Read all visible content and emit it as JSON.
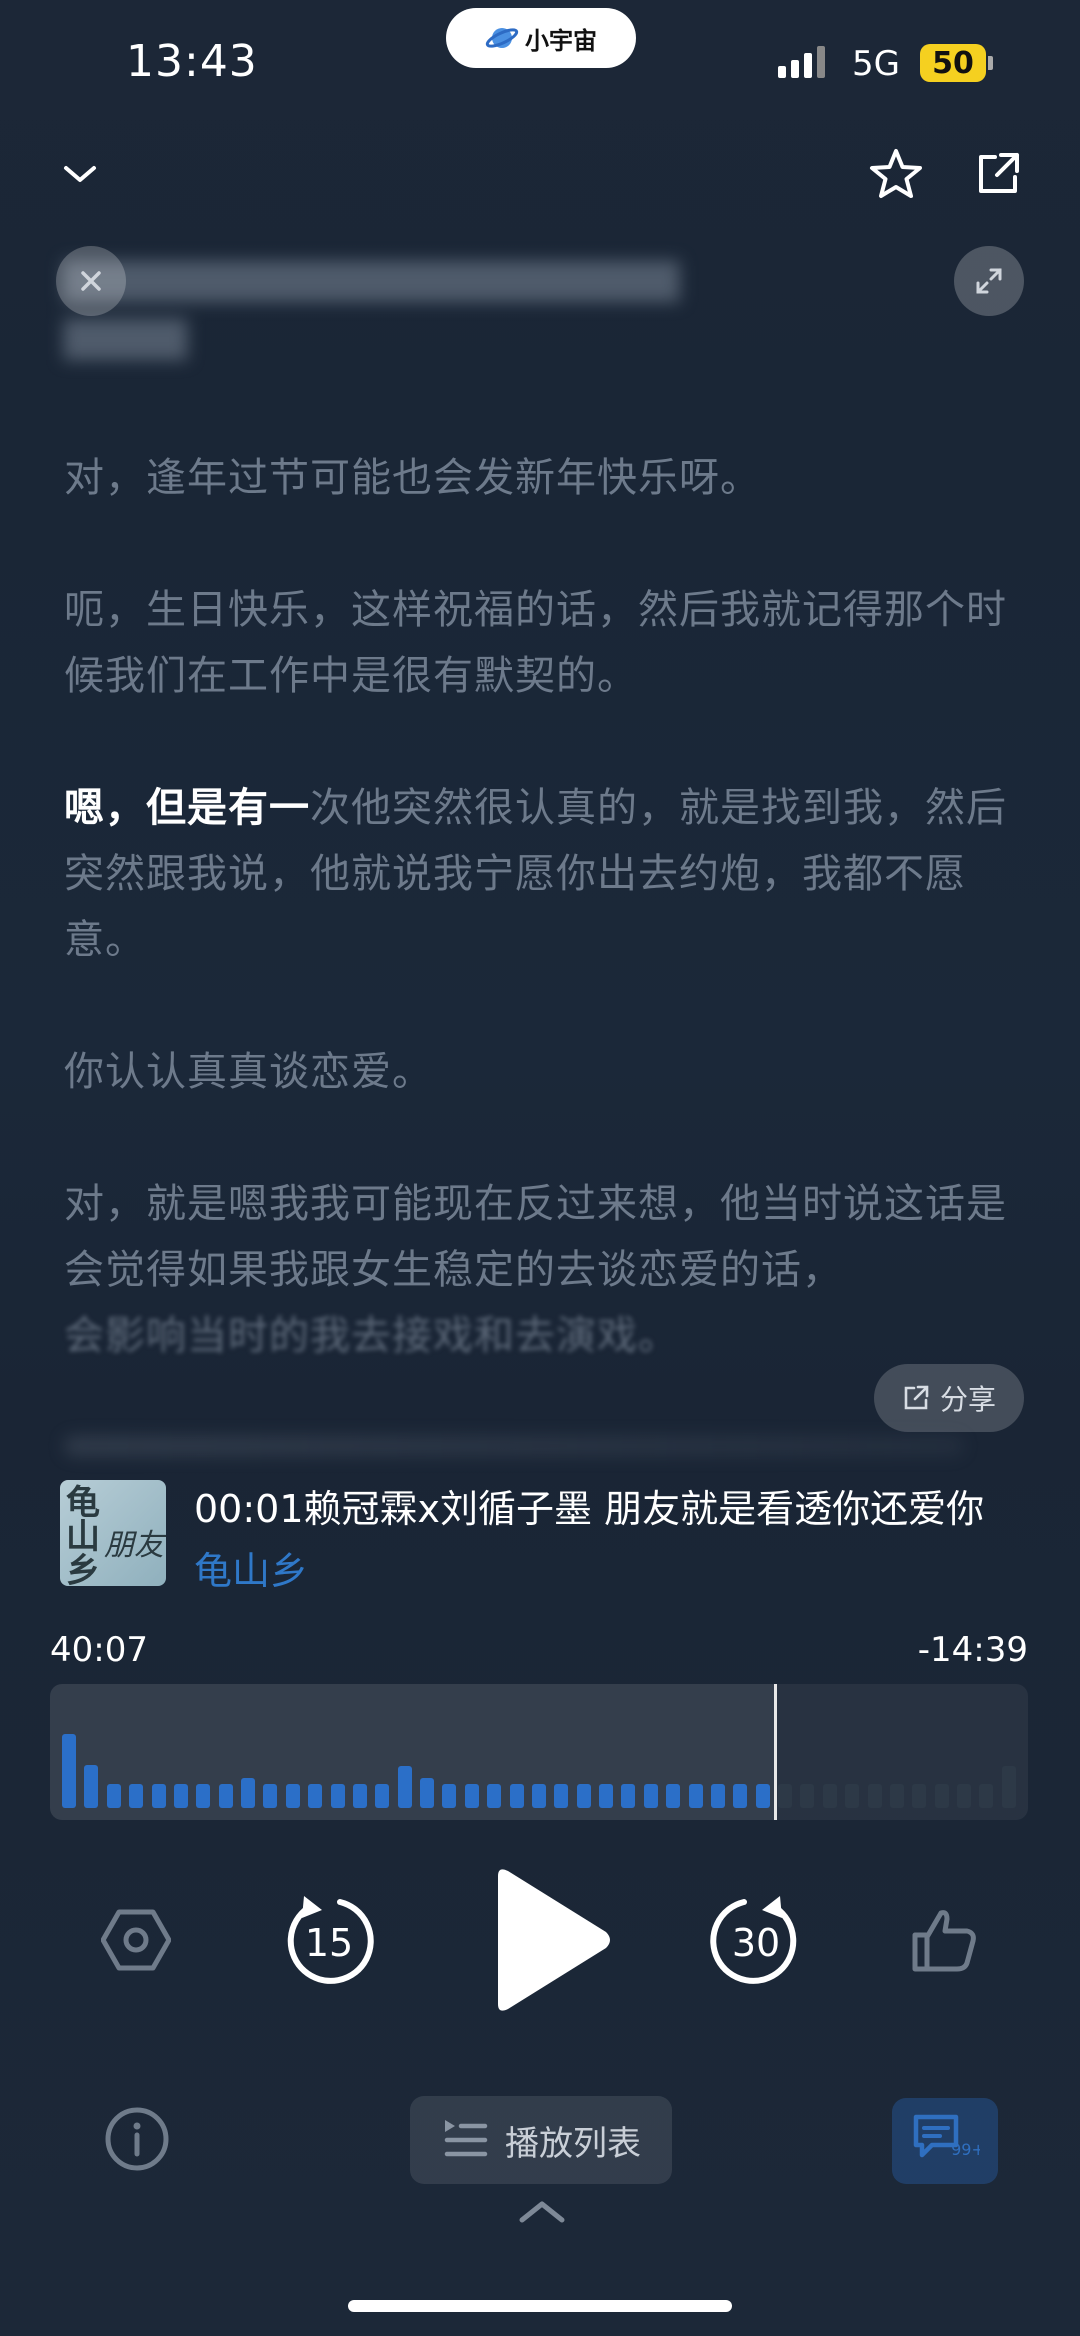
{
  "status_bar": {
    "time": "13:43",
    "app_name": "小宇宙",
    "network": "5G",
    "battery": "50"
  },
  "header": {
    "collapse_icon": "chevron-down-icon",
    "favorite_icon": "star-icon",
    "share_icon": "share-out-icon"
  },
  "transcript": {
    "paragraphs": [
      "对，逢年过节可能也会发新年快乐呀。",
      "呃，生日快乐，这样祝福的话，然后我就记得那个时候我们在工作中是很有默契的。",
      "你认认真真谈恋爱。"
    ],
    "p3_highlight": "嗯，但是有一",
    "p3_rest": "次他突然很认真的，就是找到我，然后突然跟我说，他就说我宁愿你出去约炮，我都不愿意。",
    "p5": "对，就是嗯我我可能现在反过来想，他当时说这话是会觉得如果我跟女生稳定的去谈恋爱的话，",
    "p5_fade": "会影响当时的我去接戏和去演戏。",
    "share_label": "分享"
  },
  "player": {
    "track_title": "00:01赖冠霖x刘循子墨 朋友就是看透你还爱你",
    "podcast_name": "龟山乡",
    "cover_text": {
      "a": "龟山乡",
      "b": "朋友"
    },
    "elapsed": "40:07",
    "remaining": "-14:39",
    "progress_fraction": 0.74,
    "waveform_levels": [
      0.62,
      0.36,
      0.2,
      0.2,
      0.2,
      0.2,
      0.2,
      0.2,
      0.25,
      0.2,
      0.2,
      0.2,
      0.2,
      0.2,
      0.2,
      0.35,
      0.25,
      0.2,
      0.2,
      0.2,
      0.2,
      0.2,
      0.2,
      0.2,
      0.2,
      0.2,
      0.2,
      0.2,
      0.2,
      0.2,
      0.2,
      0.2,
      0.2,
      0.2,
      0.2,
      0.2,
      0.2,
      0.2,
      0.2,
      0.2,
      0.2,
      0.2,
      0.35
    ],
    "played_color": "#2b6fc8",
    "unplayed_color": "#2d3947",
    "skip_back": "15",
    "skip_forward": "30"
  },
  "bottom": {
    "playlist_label": "播放列表",
    "comment_badge": "99+"
  }
}
